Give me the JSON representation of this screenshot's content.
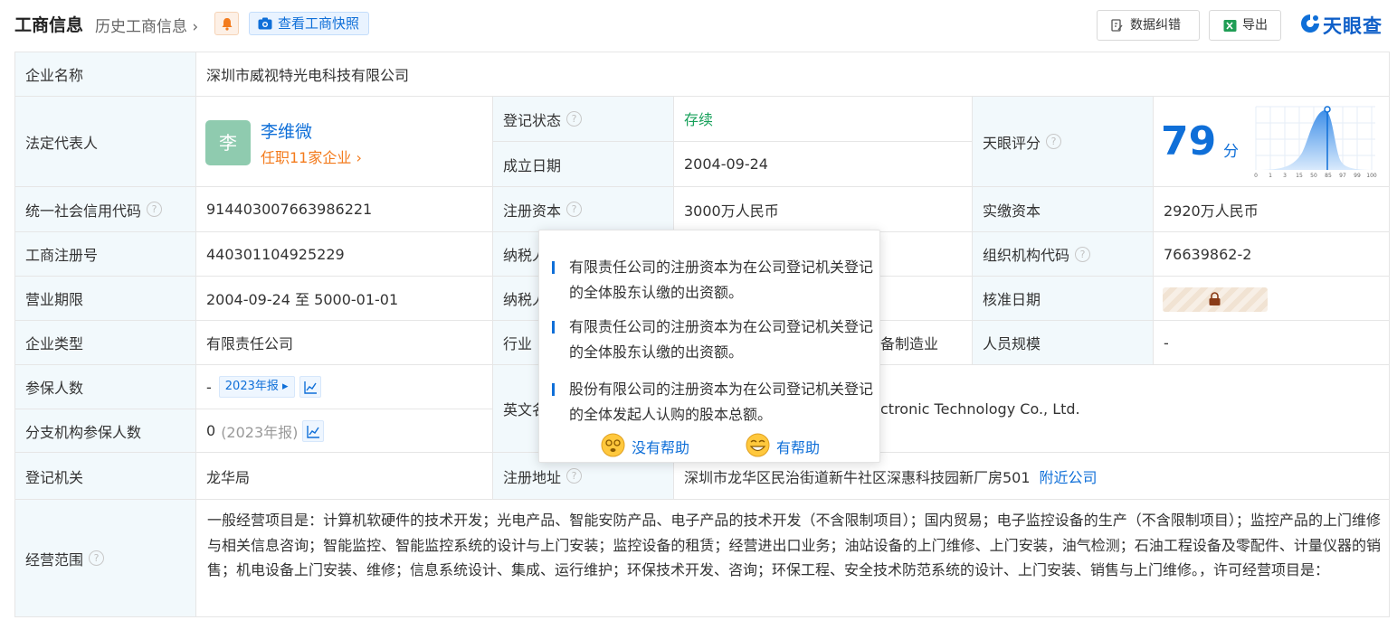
{
  "header": {
    "title": "工商信息",
    "history": "历史工商信息",
    "snapshot_label": "查看工商快照",
    "fix_label": "数据纠错",
    "export_label": "导出",
    "logo_text": "天眼查"
  },
  "rows": {
    "company_name": {
      "label": "企业名称",
      "value": "深圳市威视特光电科技有限公司"
    },
    "legal_rep": {
      "label": "法定代表人",
      "avatar": "李",
      "name": "李维微",
      "positions": "任职11家企业"
    },
    "reg_status": {
      "label": "登记状态",
      "value": "存续"
    },
    "est_date": {
      "label": "成立日期",
      "value": "2004-09-24"
    },
    "score": {
      "label": "天眼评分",
      "value": "79",
      "unit": "分",
      "axis": [
        "0",
        "1",
        "3",
        "15",
        "50",
        "85",
        "97",
        "99",
        "100"
      ]
    },
    "credit_code": {
      "label": "统一社会信用代码",
      "value": "91440300766398622​1"
    },
    "reg_capital": {
      "label": "注册资本",
      "value": "3000万人民币"
    },
    "paid_capital": {
      "label": "实缴资本",
      "value": "2920万人民币"
    },
    "reg_no": {
      "label": "工商注册号",
      "value": "440301104925229"
    },
    "taxpayer_1": {
      "label": "纳税人"
    },
    "org_code": {
      "label": "组织机构代码",
      "value": "76639862-2"
    },
    "term": {
      "label": "营业期限",
      "value": "2004-09-24 至 5000-01-01"
    },
    "taxpayer_2": {
      "label": "纳税人"
    },
    "approve_date": {
      "label": "核准日期"
    },
    "company_type": {
      "label": "企业类型",
      "value": "有限责任公司"
    },
    "industry": {
      "label": "行业",
      "value": "备制造业"
    },
    "staff_size": {
      "label": "人员规模",
      "value": "-"
    },
    "insured": {
      "label": "参保人数",
      "value": "-",
      "tag": "2023年报"
    },
    "english_name": {
      "label": "英文名",
      "value": "ctronic Technology Co., Ltd."
    },
    "branch_insured": {
      "label": "分支机构参保人数",
      "value": "0",
      "note": "(2023年报)"
    },
    "reg_authority": {
      "label": "登记机关",
      "value": "龙华局"
    },
    "reg_address": {
      "label": "注册地址",
      "value": "深圳市龙华区民治街道新牛社区深惠科技园新厂房501",
      "nearby": "附近公司"
    },
    "scope": {
      "label": "经营范围",
      "value": "一般经营项目是：计算机软硬件的技术开发；光电产品、智能安防产品、电子产品的技术开发（不含限制项目）；国内贸易；电子监控设备的生产（不含限制项目）；监控产品的上门维修与相关信息咨询；智能监控、智能监控系统的设计与上门安装；监控设备的租赁；经营进出口业务；油站设备的上门维修、上门安装，油气检测；石油工程设备及零配件、计量仪器的销售；机电设备上门安装、维修；信息系统设计、集成、运行维护；环保技术开发、咨询；环保工程、安全技术防范系统的设计、上门安装、销售与上门维修。，许可经营项目是："
    }
  },
  "tooltip": {
    "items": [
      "有限责任公司的注册资本为在公司登记机关登记的全体股东认缴的出资额。",
      "有限责任公司的注册资本为在公司登记机关登记的全体股东认缴的出资额。",
      "股份有限公司的注册资本为在公司登记机关登记的全体发起人认购的股本总额。"
    ],
    "not_helpful": "没有帮助",
    "helpful": "有帮助"
  },
  "colors": {
    "accent": "#0f6fd8",
    "label_bg": "#f2f9fc",
    "status_green": "#16a05a",
    "orange": "#f37b1d"
  }
}
